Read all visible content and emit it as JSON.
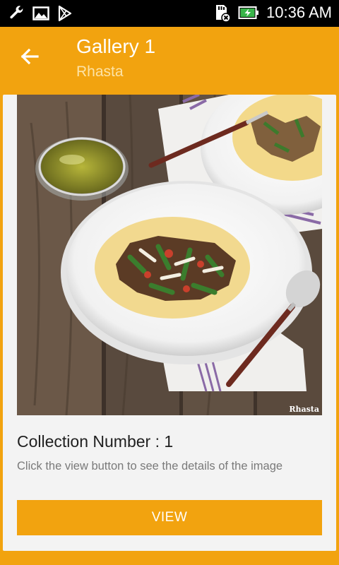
{
  "status_bar": {
    "time": "10:36 AM",
    "icons": [
      "wrench-icon",
      "image-icon",
      "play-store-icon",
      "sd-card-icon",
      "battery-charging-icon"
    ]
  },
  "app_bar": {
    "title": "Gallery 1",
    "subtitle": "Rhasta",
    "back_icon": "arrow-left-icon"
  },
  "card": {
    "image_watermark": "Rhasta",
    "collection_title": "Collection Number : 1",
    "description": "Click the view button to see the details of the image",
    "view_label": "VIEW"
  },
  "colors": {
    "accent": "#f2a30f",
    "status_bar": "#000000",
    "card_bg": "#f3f3f3"
  }
}
